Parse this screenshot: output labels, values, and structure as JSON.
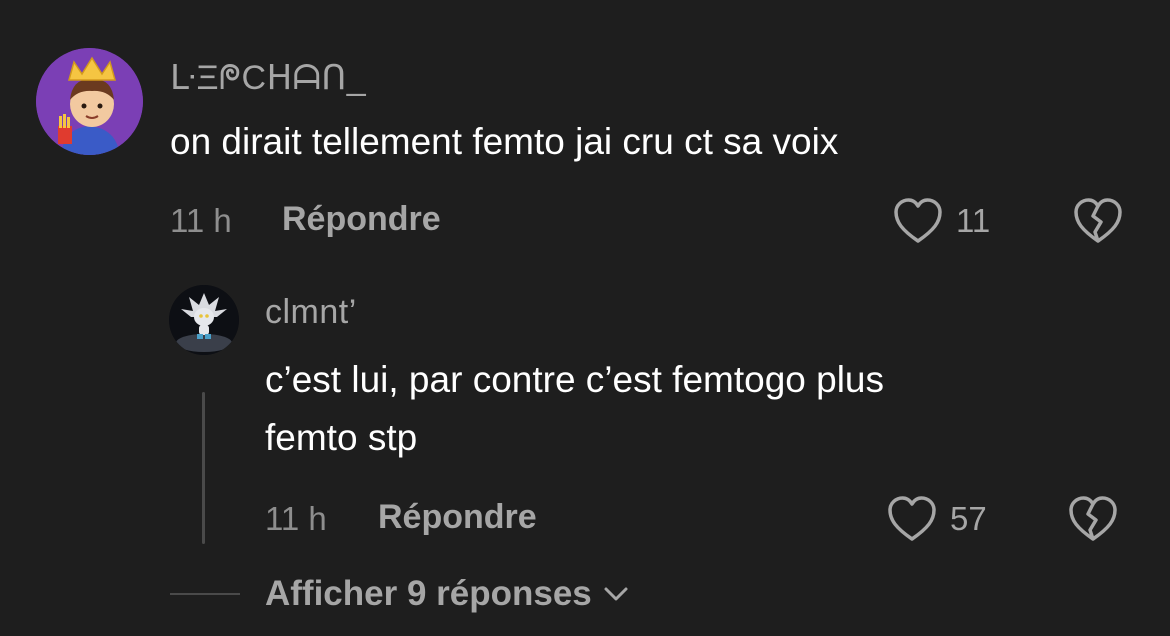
{
  "comment": {
    "username": "ᒷΞᖘCᕼᗩᑎ_",
    "text": "on dirait tellement femto jai cru ct sa voix",
    "time": "11 h",
    "reply_label": "Répondre",
    "like_count": "11",
    "avatar_icon": "kid-with-crown-avatar"
  },
  "reply": {
    "username": "clmnt’",
    "text_line1": "c’est lui, par contre c’est femtogo plus",
    "text_line2": "femto stp",
    "time": "11 h",
    "reply_label": "Répondre",
    "like_count": "57",
    "avatar_icon": "silver-hedgehog-avatar"
  },
  "view_more": {
    "label": "Afficher 9 réponses",
    "icon": "chevron-down-icon"
  },
  "colors": {
    "background": "#1e1e1e",
    "avatar_purple": "#7b3fb5",
    "muted_text": "#a6a6a6"
  }
}
